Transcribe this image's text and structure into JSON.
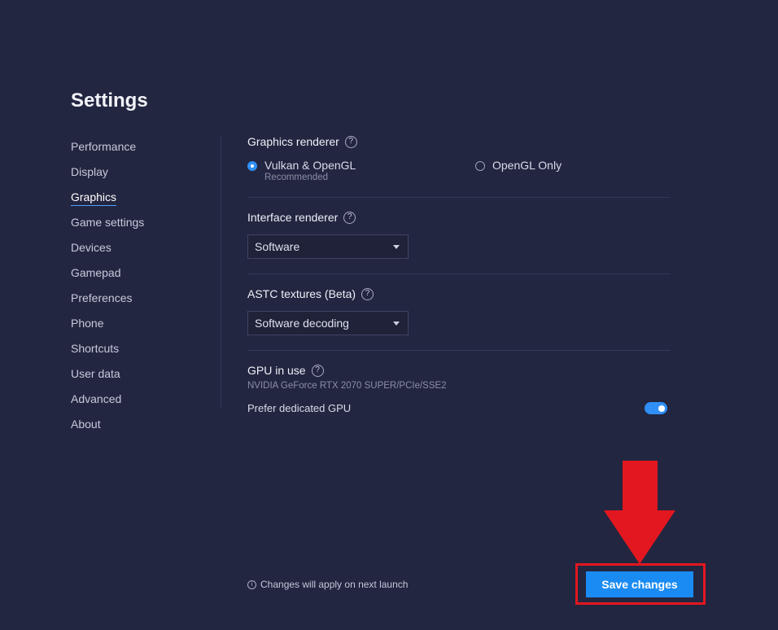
{
  "page_title": "Settings",
  "sidebar": {
    "items": [
      {
        "label": "Performance"
      },
      {
        "label": "Display"
      },
      {
        "label": "Graphics"
      },
      {
        "label": "Game settings"
      },
      {
        "label": "Devices"
      },
      {
        "label": "Gamepad"
      },
      {
        "label": "Preferences"
      },
      {
        "label": "Phone"
      },
      {
        "label": "Shortcuts"
      },
      {
        "label": "User data"
      },
      {
        "label": "Advanced"
      },
      {
        "label": "About"
      }
    ],
    "active": "Graphics"
  },
  "graphics_renderer": {
    "label": "Graphics renderer",
    "help_glyph": "?",
    "options": [
      {
        "label": "Vulkan & OpenGL",
        "sublabel": "Recommended",
        "selected": true
      },
      {
        "label": "OpenGL Only",
        "selected": false
      }
    ]
  },
  "interface_renderer": {
    "label": "Interface renderer",
    "help_glyph": "?",
    "value": "Software"
  },
  "astc_textures": {
    "label": "ASTC textures (Beta)",
    "help_glyph": "?",
    "value": "Software decoding"
  },
  "gpu": {
    "label": "GPU in use",
    "help_glyph": "?",
    "name": "NVIDIA GeForce RTX 2070 SUPER/PCIe/SSE2",
    "prefer_dedicated_label": "Prefer dedicated GPU",
    "prefer_dedicated_on": true
  },
  "footer": {
    "note": "Changes will apply on next launch",
    "info_glyph": "i",
    "save_label": "Save changes"
  },
  "colors": {
    "background": "#232640",
    "accent": "#1a8bf2",
    "annotation_red": "#e3171f"
  },
  "icons": [
    "help-icon",
    "info-icon",
    "chevron-down-icon",
    "radio-icon",
    "toggle-switch",
    "down-arrow-annotation"
  ]
}
